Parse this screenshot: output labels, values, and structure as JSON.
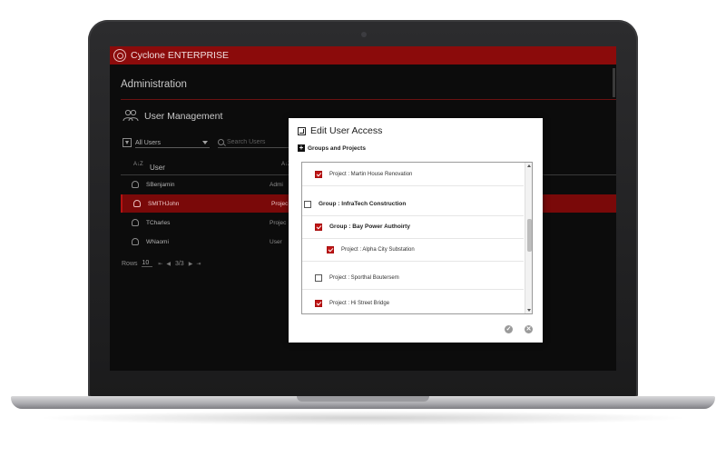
{
  "app": {
    "title": "Cyclone ENTERPRISE"
  },
  "admin": {
    "title": "Administration"
  },
  "user_management": {
    "title": "User Management",
    "filter_value": "All Users",
    "search_placeholder": "Search Users",
    "column_user": "User",
    "sort_icon": "A↓Z",
    "rows": [
      {
        "name": "SBenjamin",
        "role": "Admi"
      },
      {
        "name": "SMITHJohn",
        "role": "Projec"
      },
      {
        "name": "TCharles",
        "role": "Projec"
      },
      {
        "name": "WNaomi",
        "role": "User"
      }
    ],
    "pager": {
      "rows_label": "Rows",
      "rows_value": "10",
      "page_info": "3/3"
    }
  },
  "modal": {
    "title": "Edit User Access",
    "section_label": "Groups and Projects",
    "items": [
      {
        "label": "Project : Martin House Renovation",
        "checked": true,
        "group": false
      },
      {
        "label": "Group : InfraTech Construction",
        "checked": false,
        "group": true
      },
      {
        "label": "Group : Bay Power Authoirty",
        "checked": true,
        "group": true
      },
      {
        "label": "Project : Alpha City Substation",
        "checked": true,
        "group": false
      },
      {
        "label": "Project : Sporthal Boutersem",
        "checked": false,
        "group": false
      },
      {
        "label": "Project : Hi Street Bridge",
        "checked": true,
        "group": false
      }
    ],
    "confirm_icon": "check-circle-icon",
    "cancel_icon": "close-circle-icon"
  },
  "colors": {
    "brand_red": "#8b0b0b",
    "selection_red": "#7a0909",
    "checkbox_red": "#c11616"
  }
}
